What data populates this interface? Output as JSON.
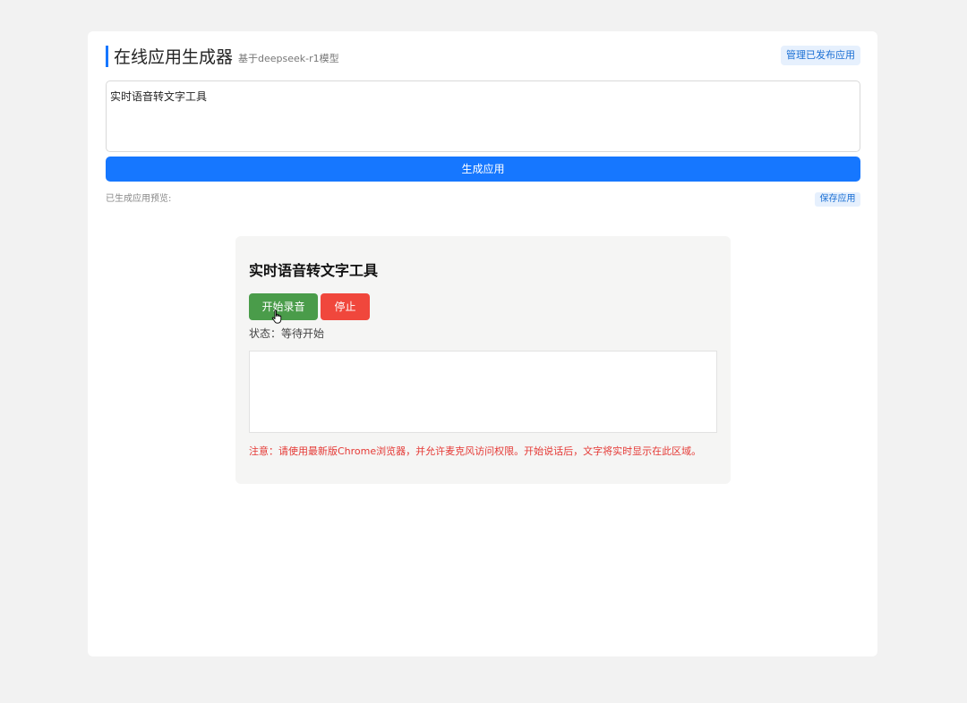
{
  "header": {
    "title": "在线应用生成器",
    "subtitle": "基于deepseek-r1模型",
    "manage_button": "管理已发布应用"
  },
  "prompt": {
    "value": "实时语音转文字工具"
  },
  "generate_button": "生成应用",
  "preview": {
    "label": "已生成应用预览:",
    "save_button": "保存应用"
  },
  "app": {
    "title": "实时语音转文字工具",
    "start_button": "开始录音",
    "stop_button": "停止",
    "status": "状态：等待开始",
    "output_text": "",
    "note": "注意：请使用最新版Chrome浏览器，并允许麦克风访问权限。开始说话后，文字将实时显示在此区域。"
  },
  "colors": {
    "primary": "#1677ff",
    "start": "#4a9c4a",
    "stop": "#f0473c",
    "warning": "#e53935"
  }
}
